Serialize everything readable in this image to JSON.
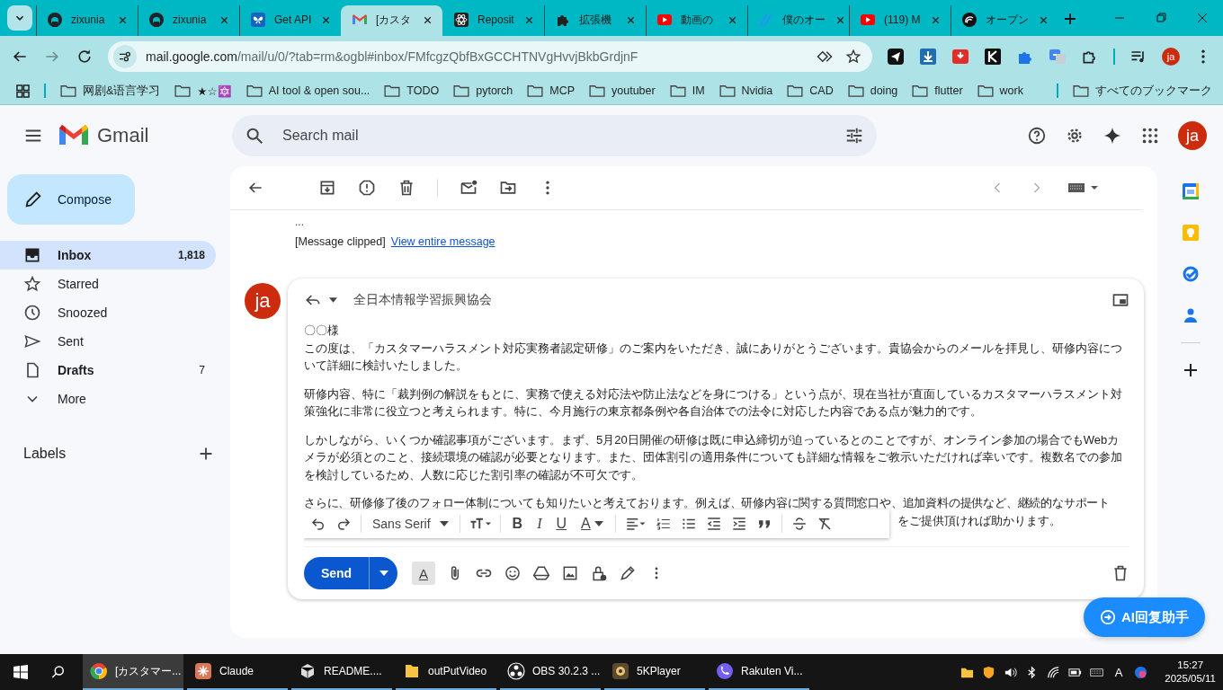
{
  "browser": {
    "tabs": [
      {
        "title": "zixunia",
        "kind": "cat",
        "selected": false
      },
      {
        "title": "zixunia",
        "kind": "cat",
        "selected": false
      },
      {
        "title": "Get API",
        "kind": "butterfly",
        "selected": false
      },
      {
        "title": "[カスタ",
        "kind": "envelope",
        "selected": true
      },
      {
        "title": "Reposit",
        "kind": "atom",
        "selected": false
      },
      {
        "title": "拡張機",
        "kind": "puzzle",
        "selected": false
      },
      {
        "title": "動画の",
        "kind": "play",
        "selected": false
      },
      {
        "title": "僕のオー",
        "kind": "stripes",
        "selected": false
      },
      {
        "title": "(119) M",
        "kind": "play",
        "selected": false
      },
      {
        "title": "オープン",
        "kind": "waves",
        "selected": false
      }
    ],
    "address": {
      "host": "mail.google.com",
      "path": "/mail/u/0/?tab=rm&ogbl#inbox/FMfcgzQbfBxGCCHTNVgHvvjBkbGrdjnF"
    },
    "profile": "ja",
    "bookmarks": [
      "网剧&语言学习",
      "★☆🔯",
      "AI tool & open sou...",
      "TODO",
      "pytorch",
      "MCP",
      "youtuber",
      "IM",
      "Nvidia",
      "CAD",
      "doing",
      "flutter",
      "work"
    ],
    "all_bookmarks": "すべてのブックマーク"
  },
  "gmail": {
    "product": "Gmail",
    "search": {
      "placeholder": "Search mail"
    },
    "account": "ja",
    "compose": "Compose",
    "nav": [
      {
        "label": "Inbox",
        "count": "1,818",
        "selected": true,
        "unread": true
      },
      {
        "label": "Starred",
        "selected": false,
        "unread": false
      },
      {
        "label": "Snoozed",
        "selected": false,
        "unread": false
      },
      {
        "label": "Sent",
        "selected": false,
        "unread": false
      },
      {
        "label": "Drafts",
        "count": "7",
        "selected": false,
        "unread": true
      },
      {
        "label": "More",
        "selected": false,
        "unread": false
      }
    ],
    "labels_heading": "Labels",
    "message": {
      "ellipsis": "...",
      "clipped": "[Message clipped]",
      "view_link": "View entire message"
    },
    "reply": {
      "avatar": "ja",
      "recipient": "全日本情報学習振興協会",
      "greeting": "〇〇様",
      "paragraphs": [
        "この度は、「カスタマーハラスメント対応実務者認定研修」のご案内をいただき、誠にありがとうございます。貴協会からのメールを拝見し、研修内容について詳細に検討いたしました。",
        "研修内容、特に「裁判例の解説をもとに、実務で使える対応法や防止法などを身につける」という点が、現在当社が直面しているカスタマーハラスメント対策強化に非常に役立つと考えられます。特に、今月施行の東京都条例や各自治体での法令に対応した内容である点が魅力的です。",
        "しかしながら、いくつか確認事項がございます。まず、5月20日開催の研修は既に申込締切が迫っているとのことですが、オンライン参加の場合でもWebカメラが必須とのこと、接続環境の確認が必要となります。また、団体割引の適用条件についても詳細な情報をご教示いただければ幸いです。複数名での参加を検討しているため、人数に応じた割引率の確認が不可欠です。"
      ],
      "partial_line": "さらに、研修修了後のフォロー体制についても知りたいと考えております。例えば、研修内容に関する質問窓口や、追加資料の提供など、継続的なサポート",
      "partial_tail": "をご提供頂ければ助かります。",
      "format": {
        "font": "Sans Serif",
        "bold": "B",
        "italic": "I",
        "underline": "U",
        "font_color": "A"
      },
      "format_toggle": "A",
      "send": "Send"
    },
    "assistant": "AI回复助手"
  },
  "taskbar": {
    "apps": [
      {
        "label": "[カスタマー...",
        "selected": true
      },
      {
        "label": "Claude",
        "selected": false
      },
      {
        "label": "README....",
        "selected": false
      },
      {
        "label": "outPutVideo",
        "selected": false
      },
      {
        "label": "OBS 30.2.3 ...",
        "selected": false
      },
      {
        "label": "5KPlayer",
        "selected": false
      },
      {
        "label": "Rakuten Vi...",
        "selected": false
      }
    ],
    "ime": "A",
    "time": "15:27",
    "date": "2025/05/11"
  }
}
